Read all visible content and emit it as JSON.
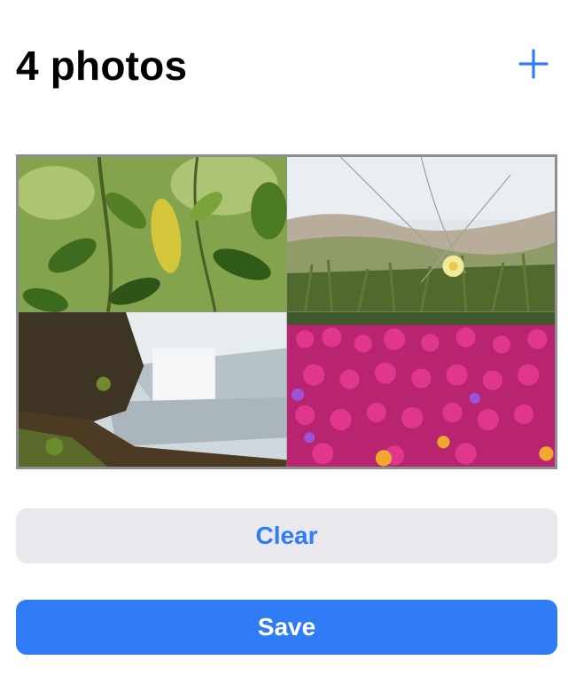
{
  "header": {
    "title": "4 photos",
    "add_icon": "plus-icon"
  },
  "photos": [
    {
      "subject": "green leaves"
    },
    {
      "subject": "dune grass and yellow flower"
    },
    {
      "subject": "waterfall"
    },
    {
      "subject": "magenta flowers"
    }
  ],
  "actions": {
    "clear_label": "Clear",
    "save_label": "Save"
  },
  "colors": {
    "accent": "#2f7cf6",
    "clear_bg": "#e8e8ed",
    "grid_border": "#8e8e93"
  }
}
